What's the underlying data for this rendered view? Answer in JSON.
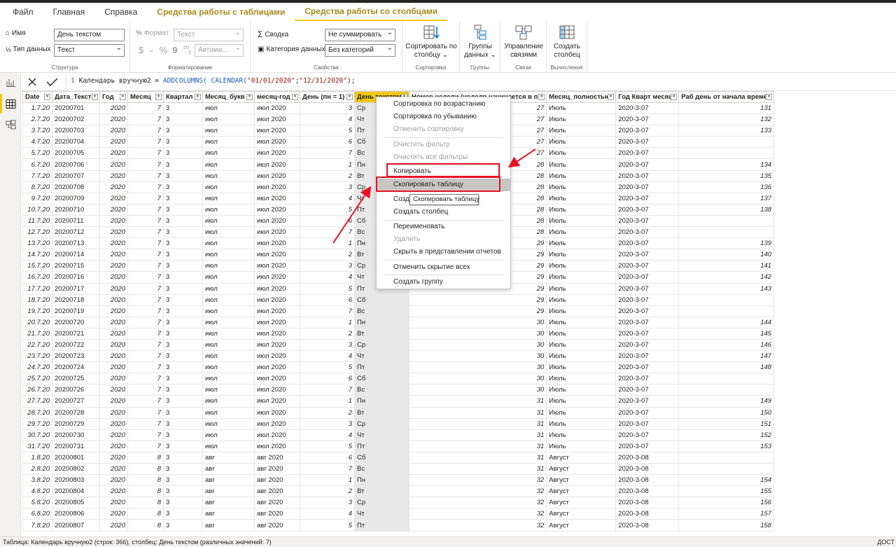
{
  "tabs": [
    "Файл",
    "Главная",
    "Справка",
    "Средства работы с таблицами",
    "Средства работы со столбцами"
  ],
  "ribbon": {
    "structure": {
      "name_label": "Имя",
      "name_value": "День текстом",
      "type_label": "Тип данных",
      "type_value": "Текст",
      "title": "Структура"
    },
    "format": {
      "format_label": "Формат",
      "format_value": "Текст",
      "auto_value": "Автома...",
      "title": "Форматирование",
      "currency": "$",
      "dash": "⌄",
      "pct": "%",
      "comma": "9",
      "dec": ".00\n→.0"
    },
    "props": {
      "summary_label": "Сводка",
      "summary_value": "Не суммировать",
      "category_label": "Категория данных",
      "category_value": "Без категорий",
      "title": "Свойства"
    },
    "sort": {
      "label1": "Сортировать по",
      "label2": "столбцу ⌄",
      "title": "Сортировка"
    },
    "groups": {
      "label1": "Группы",
      "label2": "данных ⌄",
      "title": "Группы"
    },
    "relations": {
      "label1": "Управление",
      "label2": "связями",
      "title": "Связи"
    },
    "calc": {
      "label1": "Создать",
      "label2": "столбец",
      "title": "Вычисления"
    }
  },
  "formula": {
    "line": "1",
    "p1": "Календарь вручную2 = ",
    "p2": "ADDCOLUMNS(",
    "p3": " CALENDAR(",
    "p4": "\"01/01/2020\"",
    "p5": ";",
    "p6": "\"12/31/2020\"",
    "p7": ");"
  },
  "columns": [
    "Date",
    "Дата_Текст",
    "Год",
    "Месяц",
    "Квартал",
    "Месяц_букв",
    "месяц-год",
    "День (пн = 1)",
    "День текстом",
    "Номер недели (неделя начинается в пн)",
    "Месяц_полностью",
    "Год Кварт месяц",
    "Раб день от начала времён"
  ],
  "rows": [
    [
      "1.7.20",
      "20200701",
      "2020",
      "7",
      "3",
      "июл",
      "июл 2020",
      "3",
      "Ср",
      "27",
      "Июль",
      "2020-3-07",
      "131"
    ],
    [
      "2.7.20",
      "20200702",
      "2020",
      "7",
      "3",
      "июл",
      "июл 2020",
      "4",
      "Чт",
      "27",
      "Июль",
      "2020-3-07",
      "132"
    ],
    [
      "3.7.20",
      "20200703",
      "2020",
      "7",
      "3",
      "июл",
      "июл 2020",
      "5",
      "Пт",
      "27",
      "Июль",
      "2020-3-07",
      "133"
    ],
    [
      "4.7.20",
      "20200704",
      "2020",
      "7",
      "3",
      "июл",
      "июл 2020",
      "6",
      "Сб",
      "27",
      "Июль",
      "2020-3-07",
      ""
    ],
    [
      "5.7.20",
      "20200705",
      "2020",
      "7",
      "3",
      "июл",
      "июл 2020",
      "7",
      "Вс",
      "27",
      "Июль",
      "2020-3-07",
      ""
    ],
    [
      "6.7.20",
      "20200706",
      "2020",
      "7",
      "3",
      "июл",
      "июл 2020",
      "1",
      "Пн",
      "28",
      "Июль",
      "2020-3-07",
      "134"
    ],
    [
      "7.7.20",
      "20200707",
      "2020",
      "7",
      "3",
      "июл",
      "июл 2020",
      "2",
      "Вт",
      "28",
      "Июль",
      "2020-3-07",
      "135"
    ],
    [
      "8.7.20",
      "20200708",
      "2020",
      "7",
      "3",
      "июл",
      "июл 2020",
      "3",
      "Ср",
      "28",
      "Июль",
      "2020-3-07",
      "136"
    ],
    [
      "9.7.20",
      "20200709",
      "2020",
      "7",
      "3",
      "июл",
      "июл 2020",
      "4",
      "Чт",
      "28",
      "Июль",
      "2020-3-07",
      "137"
    ],
    [
      "10.7.20",
      "20200710",
      "2020",
      "7",
      "3",
      "июл",
      "июл 2020",
      "5",
      "Пт",
      "28",
      "Июль",
      "2020-3-07",
      "138"
    ],
    [
      "11.7.20",
      "20200711",
      "2020",
      "7",
      "3",
      "июл",
      "июл 2020",
      "6",
      "Сб",
      "28",
      "Июль",
      "2020-3-07",
      ""
    ],
    [
      "12.7.20",
      "20200712",
      "2020",
      "7",
      "3",
      "июл",
      "июл 2020",
      "7",
      "Вс",
      "28",
      "Июль",
      "2020-3-07",
      ""
    ],
    [
      "13.7.20",
      "20200713",
      "2020",
      "7",
      "3",
      "июл",
      "июл 2020",
      "1",
      "Пн",
      "29",
      "Июль",
      "2020-3-07",
      "139"
    ],
    [
      "14.7.20",
      "20200714",
      "2020",
      "7",
      "3",
      "июл",
      "июл 2020",
      "2",
      "Вт",
      "29",
      "Июль",
      "2020-3-07",
      "140"
    ],
    [
      "15.7.20",
      "20200715",
      "2020",
      "7",
      "3",
      "июл",
      "июл 2020",
      "3",
      "Ср",
      "29",
      "Июль",
      "2020-3-07",
      "141"
    ],
    [
      "16.7.20",
      "20200716",
      "2020",
      "7",
      "3",
      "июл",
      "июл 2020",
      "4",
      "Чт",
      "29",
      "Июль",
      "2020-3-07",
      "142"
    ],
    [
      "17.7.20",
      "20200717",
      "2020",
      "7",
      "3",
      "июл",
      "июл 2020",
      "5",
      "Пт",
      "29",
      "Июль",
      "2020-3-07",
      "143"
    ],
    [
      "18.7.20",
      "20200718",
      "2020",
      "7",
      "3",
      "июл",
      "июл 2020",
      "6",
      "Сб",
      "29",
      "Июль",
      "2020-3-07",
      ""
    ],
    [
      "19.7.20",
      "20200719",
      "2020",
      "7",
      "3",
      "июл",
      "июл 2020",
      "7",
      "Вс",
      "29",
      "Июль",
      "2020-3-07",
      ""
    ],
    [
      "20.7.20",
      "20200720",
      "2020",
      "7",
      "3",
      "июл",
      "июл 2020",
      "1",
      "Пн",
      "30",
      "Июль",
      "2020-3-07",
      "144"
    ],
    [
      "21.7.20",
      "20200721",
      "2020",
      "7",
      "3",
      "июл",
      "июл 2020",
      "2",
      "Вт",
      "30",
      "Июль",
      "2020-3-07",
      "145"
    ],
    [
      "22.7.20",
      "20200722",
      "2020",
      "7",
      "3",
      "июл",
      "июл 2020",
      "3",
      "Ср",
      "30",
      "Июль",
      "2020-3-07",
      "146"
    ],
    [
      "23.7.20",
      "20200723",
      "2020",
      "7",
      "3",
      "июл",
      "июл 2020",
      "4",
      "Чт",
      "30",
      "Июль",
      "2020-3-07",
      "147"
    ],
    [
      "24.7.20",
      "20200724",
      "2020",
      "7",
      "3",
      "июл",
      "июл 2020",
      "5",
      "Пт",
      "30",
      "Июль",
      "2020-3-07",
      "148"
    ],
    [
      "25.7.20",
      "20200725",
      "2020",
      "7",
      "3",
      "июл",
      "июл 2020",
      "6",
      "Сб",
      "30",
      "Июль",
      "2020-3-07",
      ""
    ],
    [
      "26.7.20",
      "20200726",
      "2020",
      "7",
      "3",
      "июл",
      "июл 2020",
      "7",
      "Вс",
      "30",
      "Июль",
      "2020-3-07",
      ""
    ],
    [
      "27.7.20",
      "20200727",
      "2020",
      "7",
      "3",
      "июл",
      "июл 2020",
      "1",
      "Пн",
      "31",
      "Июль",
      "2020-3-07",
      "149"
    ],
    [
      "28.7.20",
      "20200728",
      "2020",
      "7",
      "3",
      "июл",
      "июл 2020",
      "2",
      "Вт",
      "31",
      "Июль",
      "2020-3-07",
      "150"
    ],
    [
      "29.7.20",
      "20200729",
      "2020",
      "7",
      "3",
      "июл",
      "июл 2020",
      "3",
      "Ср",
      "31",
      "Июль",
      "2020-3-07",
      "151"
    ],
    [
      "30.7.20",
      "20200730",
      "2020",
      "7",
      "3",
      "июл",
      "июл 2020",
      "4",
      "Чт",
      "31",
      "Июль",
      "2020-3-07",
      "152"
    ],
    [
      "31.7.20",
      "20200731",
      "2020",
      "7",
      "3",
      "июл",
      "июл 2020",
      "5",
      "Пт",
      "31",
      "Июль",
      "2020-3-07",
      "153"
    ],
    [
      "1.8.20",
      "20200801",
      "2020",
      "8",
      "3",
      "авг",
      "авг 2020",
      "6",
      "Сб",
      "31",
      "Август",
      "2020-3-08",
      ""
    ],
    [
      "2.8.20",
      "20200802",
      "2020",
      "8",
      "3",
      "авг",
      "авг 2020",
      "7",
      "Вс",
      "31",
      "Август",
      "2020-3-08",
      ""
    ],
    [
      "3.8.20",
      "20200803",
      "2020",
      "8",
      "3",
      "авг",
      "авг 2020",
      "1",
      "Пн",
      "32",
      "Август",
      "2020-3-08",
      "154"
    ],
    [
      "4.8.20",
      "20200804",
      "2020",
      "8",
      "3",
      "авг",
      "авг 2020",
      "2",
      "Вт",
      "32",
      "Август",
      "2020-3-08",
      "155"
    ],
    [
      "5.8.20",
      "20200805",
      "2020",
      "8",
      "3",
      "авг",
      "авг 2020",
      "3",
      "Ср",
      "32",
      "Август",
      "2020-3-08",
      "156"
    ],
    [
      "6.8.20",
      "20200806",
      "2020",
      "8",
      "3",
      "авг",
      "авг 2020",
      "4",
      "Чт",
      "32",
      "Август",
      "2020-3-08",
      "157"
    ],
    [
      "7.8.20",
      "20200807",
      "2020",
      "8",
      "3",
      "авг",
      "авг 2020",
      "5",
      "Пт",
      "32",
      "Август",
      "2020-3-08",
      "158"
    ]
  ],
  "menu": {
    "sort_asc": "Сортировка по возрастанию",
    "sort_desc": "Сортировка по убыванию",
    "sort_cancel": "Отменить сортировку",
    "clear_filter": "Очистить фильтр",
    "clear_all": "Очистить все фильтры",
    "copy": "Копировать",
    "copy_table": "Скопировать таблицу",
    "new_measure": "Созд",
    "new_column": "Создать столбец",
    "rename": "Переименовать",
    "delete": "Удалить",
    "hide": "Скрыть в представлении отчетов",
    "unhide_all": "Отменить скрытие всех",
    "new_group": "Создать группу"
  },
  "tooltip": "Скопировать таблицу",
  "status": {
    "left": "Таблица: Календарь вручную2 (строк: 366), столбец: День текстом (различных значений: 7)",
    "right": "ДОСТ"
  },
  "colors": {
    "accent": "#f2c811",
    "context_tab": "#a68b1c",
    "annotation": "#e81123"
  }
}
